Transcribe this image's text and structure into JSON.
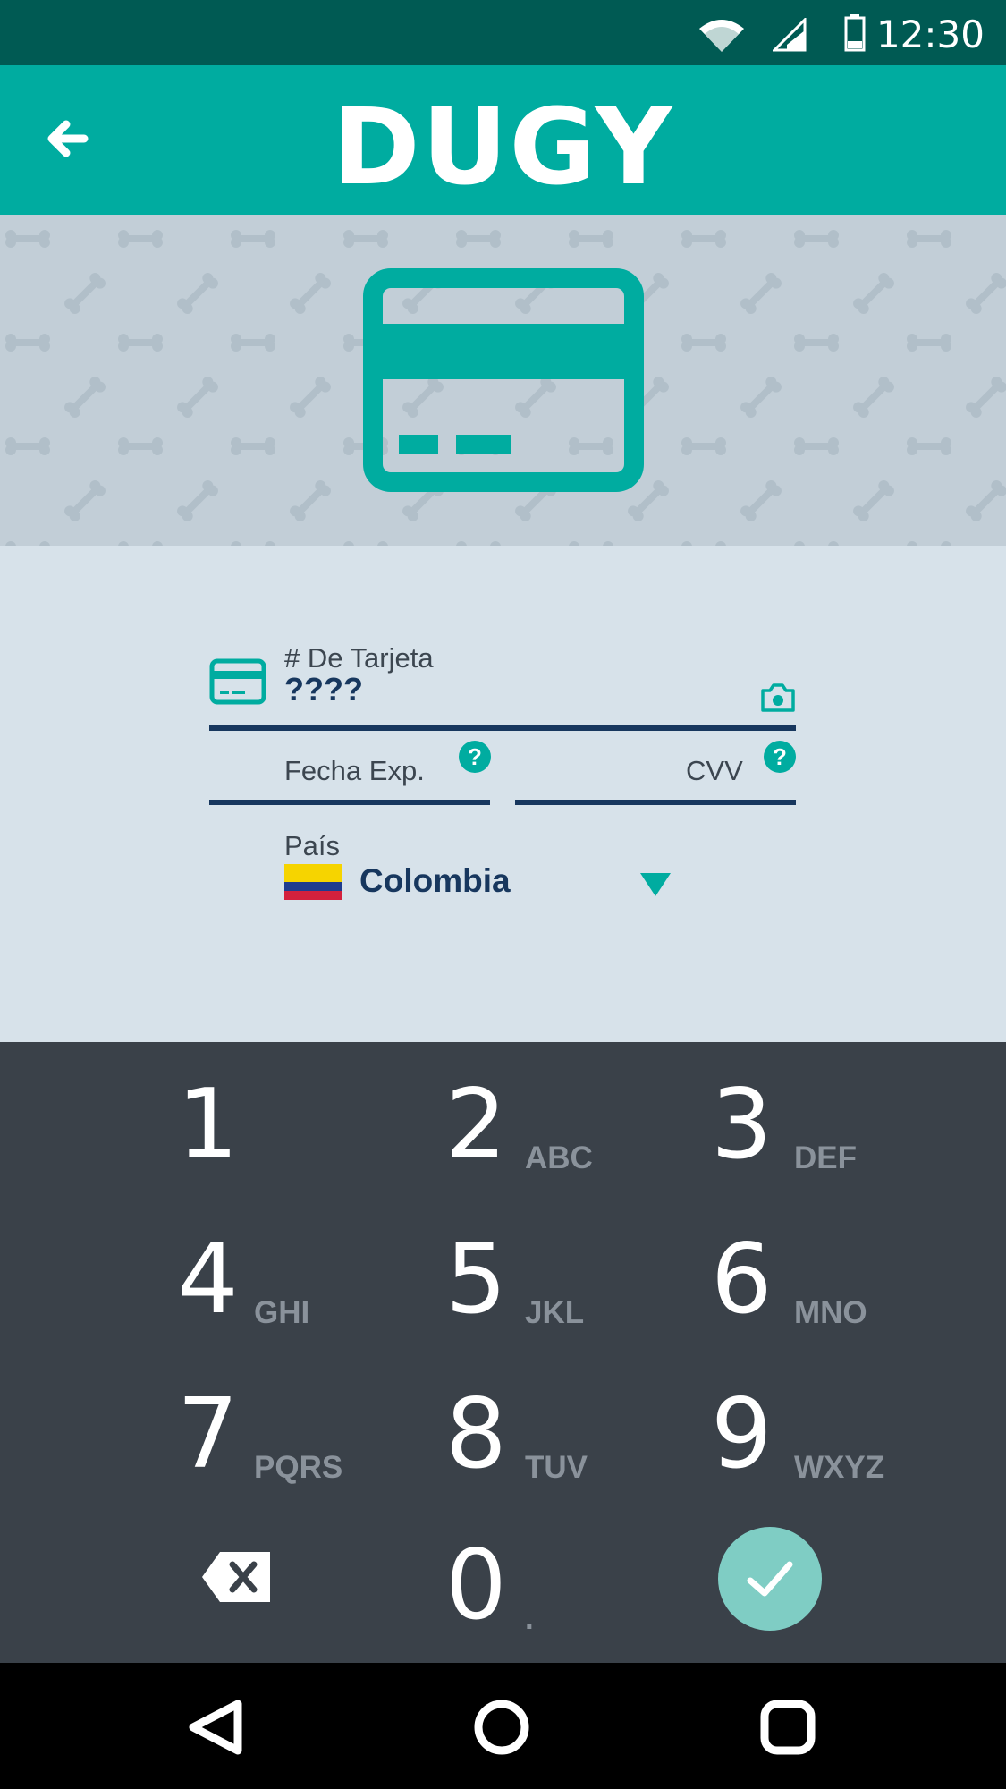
{
  "status_bar": {
    "time": "12:30"
  },
  "app_bar": {
    "brand": "DUGY"
  },
  "form": {
    "card_number_label": "# De Tarjeta",
    "card_number_value": "????",
    "expiry_label": "Fecha Exp.",
    "cvv_label": "CVV",
    "help_glyph": "?",
    "country_label": "País",
    "country_value": "Colombia"
  },
  "keypad": {
    "keys": [
      {
        "digit": "1",
        "letters": ""
      },
      {
        "digit": "2",
        "letters": "ABC"
      },
      {
        "digit": "3",
        "letters": "DEF"
      },
      {
        "digit": "4",
        "letters": "GHI"
      },
      {
        "digit": "5",
        "letters": "JKL"
      },
      {
        "digit": "6",
        "letters": "MNO"
      },
      {
        "digit": "7",
        "letters": "PQRS"
      },
      {
        "digit": "8",
        "letters": "TUV"
      },
      {
        "digit": "9",
        "letters": "WXYZ"
      },
      {
        "digit": "0",
        "letters": "."
      }
    ]
  },
  "colors": {
    "primary": "#00aca0",
    "status_bar": "#005a53",
    "field_line": "#17375e",
    "keypad_bg": "#3a4149",
    "confirm": "#7fcdc4"
  }
}
